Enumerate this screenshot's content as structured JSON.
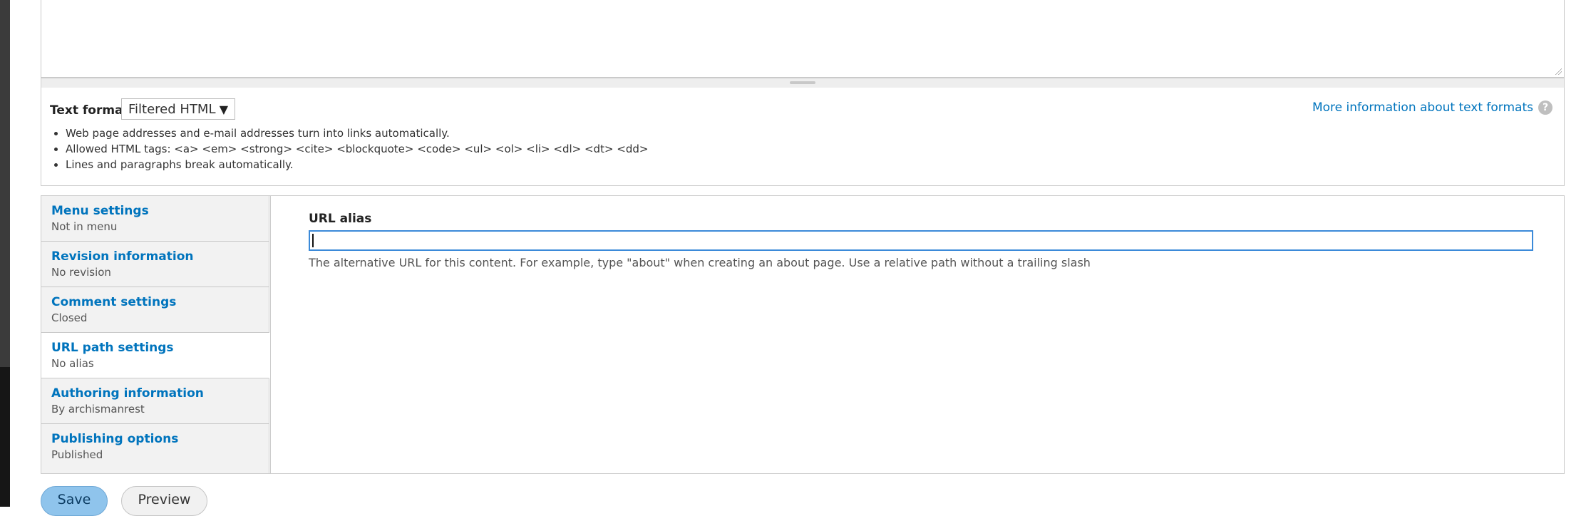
{
  "text_format": {
    "label": "Text format",
    "selected": "Filtered HTML",
    "help_link": "More information about text formats",
    "tips": [
      "Web page addresses and e-mail addresses turn into links automatically.",
      "Allowed HTML tags: <a> <em> <strong> <cite> <blockquote> <code> <ul> <ol> <li> <dl> <dt> <dd>",
      "Lines and paragraphs break automatically."
    ]
  },
  "vertical_tabs": [
    {
      "title": "Menu settings",
      "summary": "Not in menu"
    },
    {
      "title": "Revision information",
      "summary": "No revision"
    },
    {
      "title": "Comment settings",
      "summary": "Closed"
    },
    {
      "title": "URL path settings",
      "summary": "No alias",
      "selected": true
    },
    {
      "title": "Authoring information",
      "summary": "By archismanrest"
    },
    {
      "title": "Publishing options",
      "summary": "Published"
    }
  ],
  "url_alias": {
    "label": "URL alias",
    "value": "",
    "description": "The alternative URL for this content. For example, type \"about\" when creating an about page. Use a relative path without a trailing slash"
  },
  "actions": {
    "save": "Save",
    "preview": "Preview"
  },
  "colors": {
    "link": "#0074bd",
    "focus": "#3b8ad9",
    "save_button": "#8fc4ec"
  }
}
